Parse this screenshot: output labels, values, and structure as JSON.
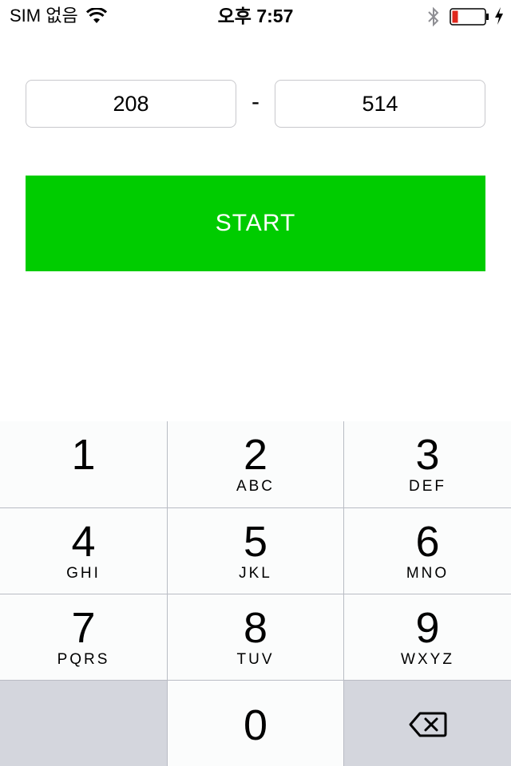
{
  "status_bar": {
    "carrier": "SIM 없음",
    "time": "오후 7:57",
    "icons": [
      "wifi-icon",
      "bluetooth-icon",
      "battery-icon",
      "charging-icon"
    ],
    "battery_color": "#e0271d"
  },
  "range": {
    "start_value": "208",
    "separator": "-",
    "end_value": "514"
  },
  "start_button": {
    "label": "START",
    "color": "#00cc00"
  },
  "keypad": {
    "keys": [
      {
        "digit": "1",
        "letters": ""
      },
      {
        "digit": "2",
        "letters": "ABC"
      },
      {
        "digit": "3",
        "letters": "DEF"
      },
      {
        "digit": "4",
        "letters": "GHI"
      },
      {
        "digit": "5",
        "letters": "JKL"
      },
      {
        "digit": "6",
        "letters": "MNO"
      },
      {
        "digit": "7",
        "letters": "PQRS"
      },
      {
        "digit": "8",
        "letters": "TUV"
      },
      {
        "digit": "9",
        "letters": "WXYZ"
      },
      {
        "digit": "0",
        "letters": ""
      }
    ],
    "delete_icon": "backspace-icon"
  }
}
